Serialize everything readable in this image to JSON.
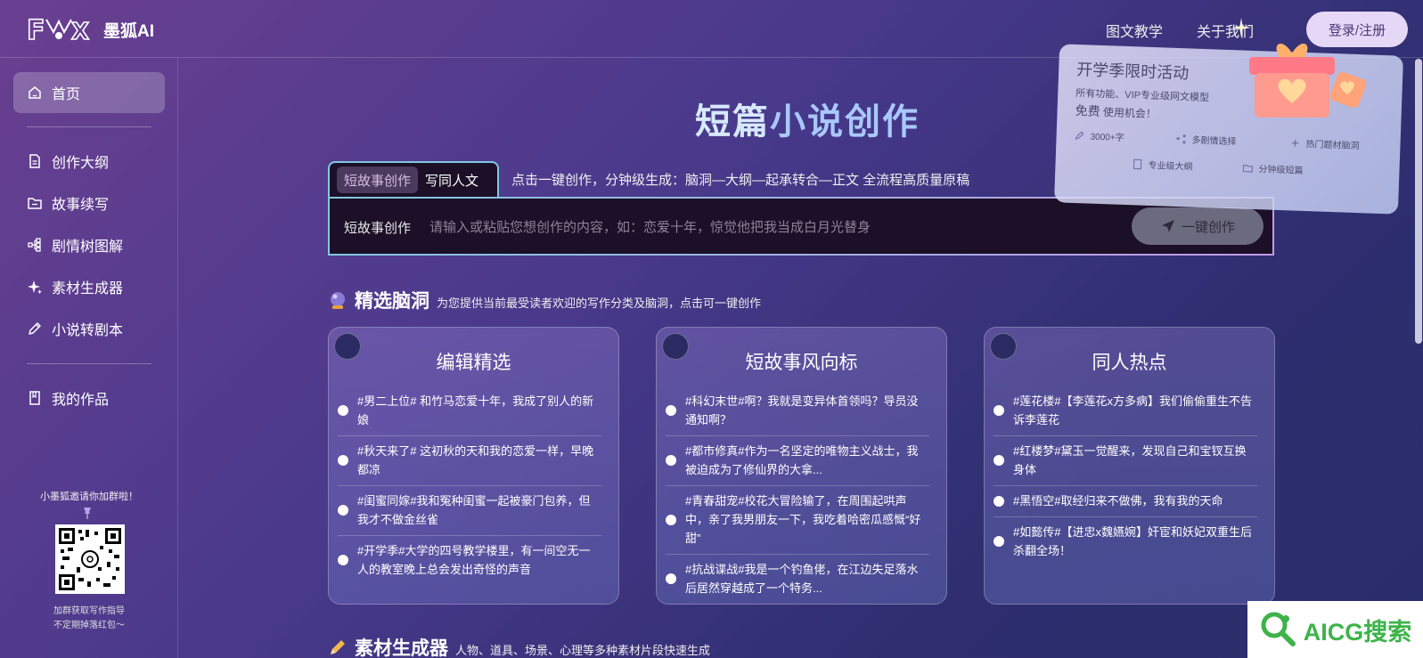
{
  "header": {
    "logo_text": "墨狐AI",
    "nav": [
      "图文教学",
      "关于我们"
    ],
    "login_label": "登录/注册"
  },
  "sidebar": {
    "items": [
      {
        "label": "首页",
        "icon": "home-icon",
        "active": true
      },
      {
        "label": "创作大纲",
        "icon": "document-icon"
      },
      {
        "label": "故事续写",
        "icon": "folder-icon"
      },
      {
        "label": "剧情树图解",
        "icon": "tree-icon"
      },
      {
        "label": "素材生成器",
        "icon": "sparkle-icon"
      },
      {
        "label": "小说转剧本",
        "icon": "pencil-icon"
      },
      {
        "label": "我的作品",
        "icon": "book-icon"
      }
    ],
    "qr_title": "小墨狐邀请你加群啦！",
    "qr_caption_1": "加群获取写作指导",
    "qr_caption_2": "不定期掉落红包～"
  },
  "main": {
    "title_part1": "短篇",
    "title_part2": "小说创作",
    "tabs": [
      {
        "label": "短故事创作",
        "active": true
      },
      {
        "label": "写同人文",
        "active": false
      }
    ],
    "tab_description": "点击一键创作，分钟级生成：脑洞—大纲—起承转合—正文 全流程高质量原稿",
    "input_label": "短故事创作",
    "input_placeholder": "请输入或粘贴您想创作的内容，如：恋爱十年，惊觉他把我当成白月光替身",
    "input_value": "",
    "create_button": "一键创作",
    "ideas_title": "精选脑洞",
    "ideas_subtitle": "为您提供当前最受读者欢迎的写作分类及脑洞，点击可一键创作",
    "material_title": "素材生成器",
    "material_subtitle": "人物、道具、场景、心理等多种素材片段快速生成"
  },
  "cards": [
    {
      "title": "编辑精选",
      "items": [
        "#男二上位# 和竹马恋爱十年，我成了别人的新娘",
        "#秋天来了# 这初秋的天和我的恋爱一样，早晚都凉",
        "#闺蜜同嫁#我和冤种闺蜜一起被豪门包养，但我才不做金丝雀",
        "#开学季#大学的四号教学楼里，有一间空无一人的教室晚上总会发出奇怪的声音"
      ]
    },
    {
      "title": "短故事风向标",
      "items": [
        "#科幻末世#啊？我就是变异体首领吗？导员没通知啊？",
        "#都市修真#作为一名坚定的唯物主义战士，我被迫成为了修仙界的大拿...",
        "#青春甜宠#校花大冒险输了，在周围起哄声中，亲了我男朋友一下，我吃着哈密瓜感慨“好甜”",
        "#抗战谍战#我是一个钓鱼佬，在江边失足落水后居然穿越成了一个特务..."
      ]
    },
    {
      "title": "同人热点",
      "items": [
        "#莲花楼#【李莲花x方多病】我们偷偷重生不告诉李莲花",
        "#红楼梦#黛玉一觉醒来，发现自己和宝钗互换身体",
        "#黑悟空#取经归来不做佛，我有我的天命",
        "#如懿传#【进忠x魏嬿婉】奸宦和妖妃双重生后杀翻全场！"
      ]
    }
  ],
  "promo": {
    "title": "开学季限时活动",
    "subtitle": "所有功能、VIP专业级网文模型",
    "free_word": "免费",
    "free_rest": "使用机会！",
    "features": [
      "3000+字",
      "多剧情选择",
      "热门题材脑洞",
      "专业级大纲",
      "分钟级短篇"
    ]
  },
  "watermark": "AICG搜索",
  "colors": {
    "accent_title": "#a9c8ff",
    "input_border_start": "#80c8e0",
    "input_border_end": "#c29ae4",
    "watermark_green": "#3db34a"
  }
}
